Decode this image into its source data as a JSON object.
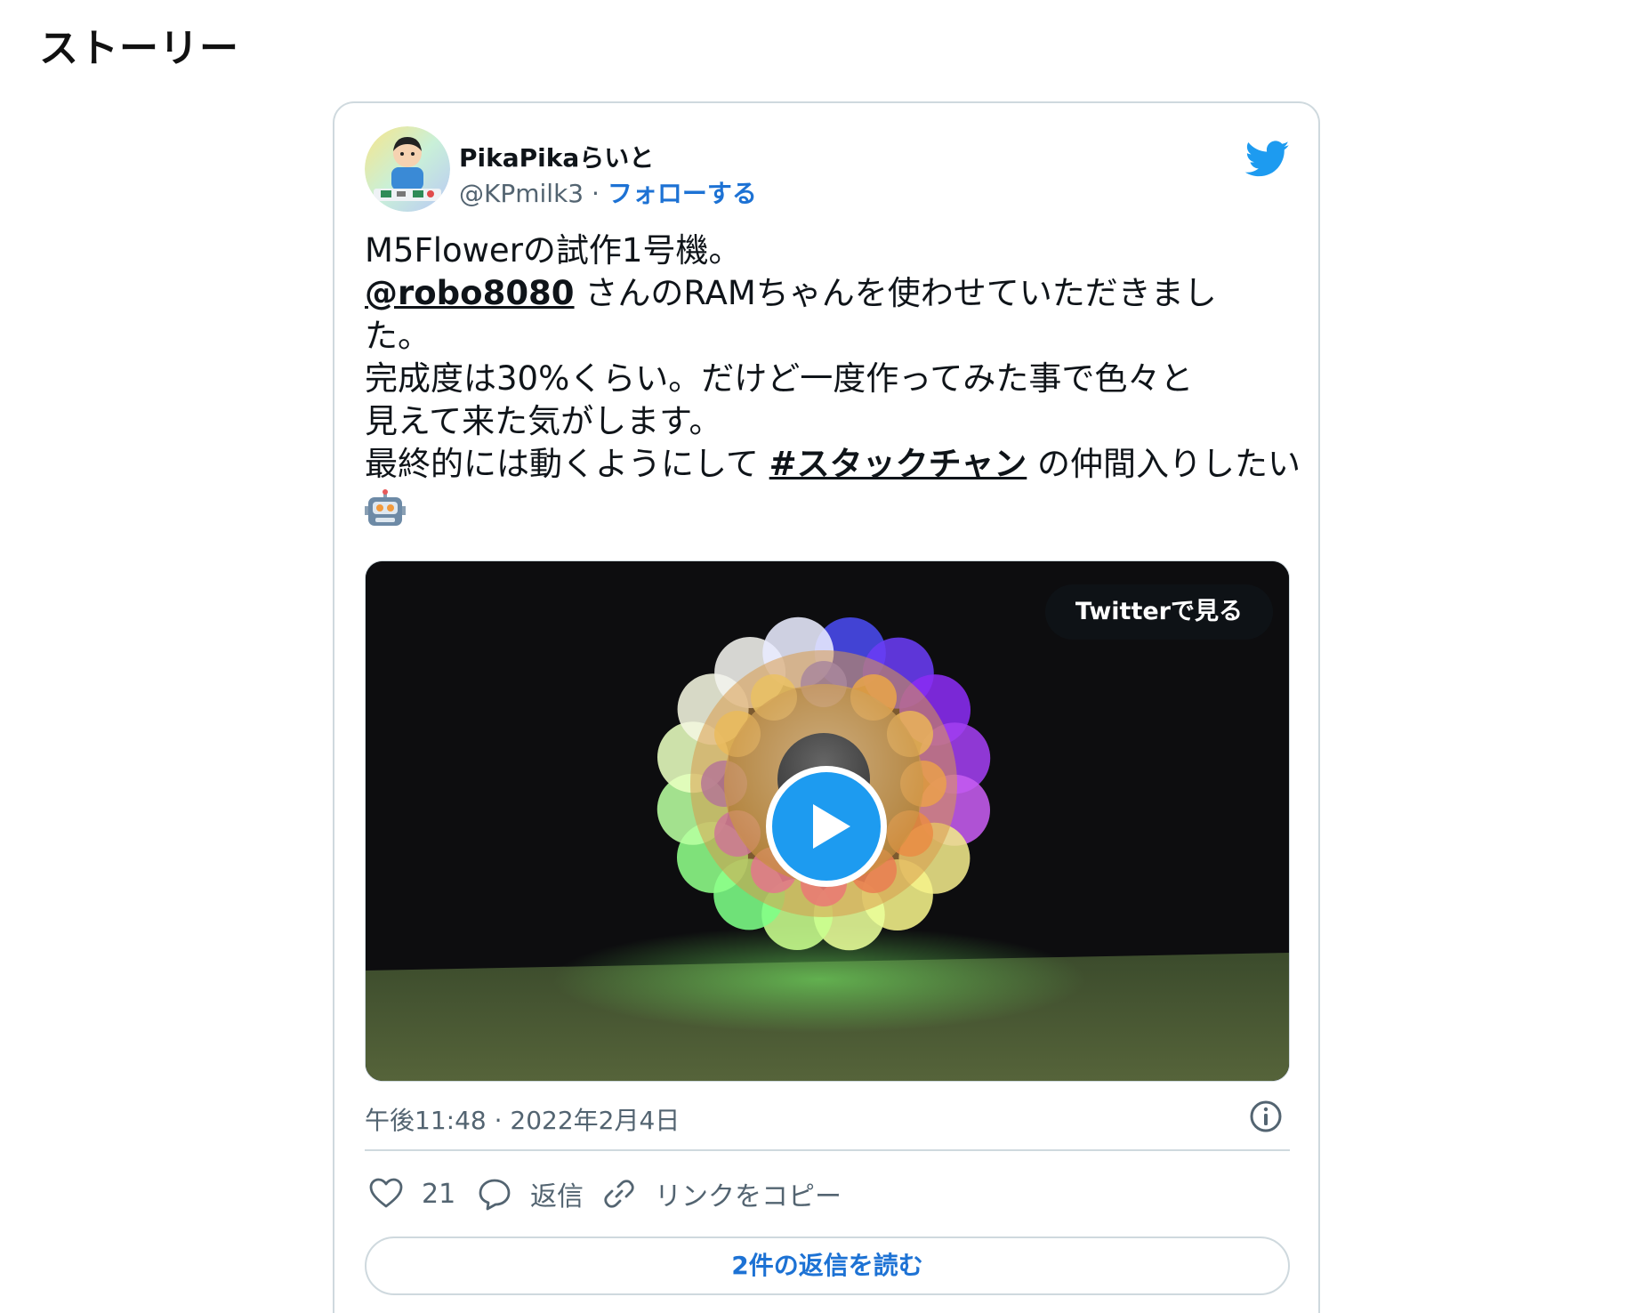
{
  "section": {
    "title": "ストーリー"
  },
  "tweet": {
    "author": {
      "display_name": "PikaPikaらいと",
      "handle": "@KPmilk3",
      "separator": "·",
      "follow_label": "フォローする",
      "avatar_icon": "boy-with-electronics-avatar"
    },
    "brand_icon": "twitter-bird-icon",
    "text": {
      "line1": "M5Flowerの試作1号機。",
      "mention": "@robo8080",
      "line2_rest": " さんのRAMちゃんを使わせていただきまし",
      "line3": "た。",
      "line4": "完成度は30%くらい。だけど一度作ってみた事で色々と",
      "line5": "見えて来た気がします。",
      "line6_start": "最終的には動くようにして ",
      "hashtag": "#スタックチャン",
      "line6_end": " の仲間入りしたい",
      "emoji": "robot-emoji"
    },
    "media": {
      "watch_label": "Twitterで見る",
      "play_icon": "play-icon"
    },
    "timestamp": "午後11:48 · 2022年2月4日",
    "info_icon": "info-icon",
    "actions": {
      "likes_count": "21",
      "reply_label": "返信",
      "copy_link_label": "リンクをコピー"
    },
    "read_replies_label": "2件の返信を読む"
  },
  "colors": {
    "link_blue": "#1d72d4",
    "twitter_blue": "#1d9bf0",
    "muted_text": "#536471",
    "border": "#cfd9de"
  }
}
